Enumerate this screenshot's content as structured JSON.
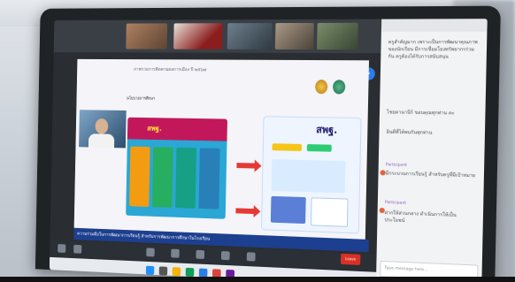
{
  "scene": {
    "description_labels": {
      "slide_title": "ภาพรวมการติดตามผลการเมือง ปี ๒๕๖๗",
      "slide_subtitle": "นโยบายการศึกษา",
      "panel_heading": "สพฐ.",
      "right_panel_heading": "สพฐ.",
      "caption": "ความร่วมมือในการพัฒนาการเรียนรู้ สำหรับการพัฒนาการศึกษาในโรงเรียน",
      "share_icon": "share-icon",
      "leave_label": "Leave"
    },
    "chat": {
      "messages": [
        "ครูสำคัญมาก เพราะเป็นการพัฒนาคุณภาพของนักเรียน มีการเชื่อมโยงทรัพยากรร่วมกัน ครูต้องได้รับการสนับสนุน",
        "ไชยดานานีร์ ขอบคุณทุกท่าน คะ",
        "ยินดีที่ได้พบกันทุกท่าน",
        "มีกระบวนการเรียนรู้ สำหรับครูที่มีเป้าหมาย",
        "ฝากให้ส่วนกลาง ดำเนินการให้เป็นประโยชน์"
      ],
      "names": [
        "Participant",
        "Participant"
      ],
      "input_placeholder": "Type message here..."
    },
    "colors": {
      "accent": "#2b7de9",
      "leave": "#d93025",
      "caption_bg": "#1d3f8f"
    }
  }
}
